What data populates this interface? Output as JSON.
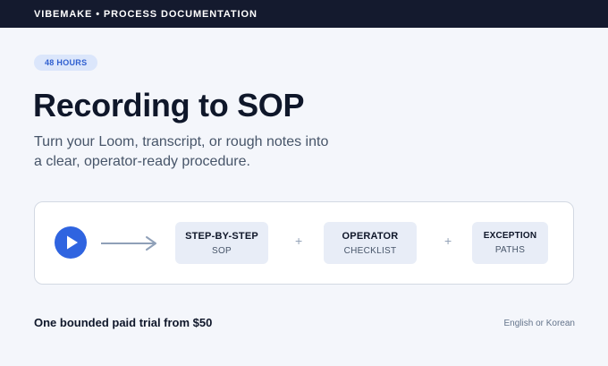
{
  "header": {
    "brand": "VIBEMAKE • PROCESS DOCUMENTATION"
  },
  "badge": "48 HOURS",
  "hero": {
    "title": "Recording to SOP",
    "subtitle": "Turn your Loom, transcript, or rough notes into a clear, operator-ready procedure."
  },
  "flow": {
    "play_icon": "play-icon",
    "arrow_icon": "arrow-right-icon",
    "outputs": [
      {
        "title": "STEP-BY-STEP",
        "subtitle": "SOP"
      },
      {
        "title": "OPERATOR",
        "subtitle": "CHECKLIST"
      },
      {
        "title": "EXCEPTION",
        "subtitle": "PATHS"
      }
    ],
    "separator": "+"
  },
  "footer": {
    "trial": "One bounded paid trial from $50",
    "languages": "English or Korean"
  },
  "colors": {
    "topbar": "#141a2e",
    "accent": "#2f64e0",
    "badge_bg": "#dbe6fb",
    "badge_text": "#2f5fd0",
    "box_bg": "#e8edf7",
    "page_bg": "#f4f6fb"
  }
}
